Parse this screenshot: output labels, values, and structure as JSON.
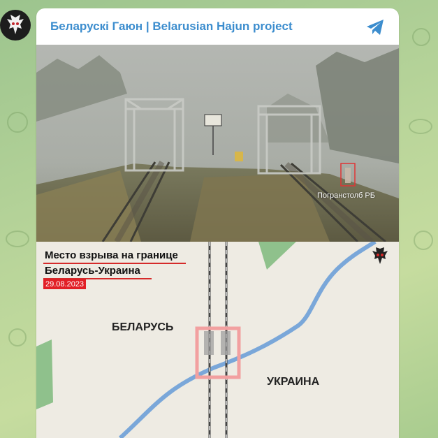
{
  "channel": {
    "title": "Беларускі Гаюн | Belarusian Hajun project"
  },
  "icons": {
    "avatar": "hajun-logo-icon",
    "share": "telegram-plane-icon"
  },
  "photo": {
    "marker_label": "Погранстолб РБ"
  },
  "map": {
    "title_line1": "Место взрыва на границе",
    "title_line2": "Беларусь-Украина",
    "date": "29.08.2023",
    "label_belarus": "БЕЛАРУСЬ",
    "label_ukraine": "УКРАИНА"
  },
  "colors": {
    "title_blue": "#3c8dce",
    "accent_red": "#e21f26",
    "border_line": "#7aa7d9"
  }
}
